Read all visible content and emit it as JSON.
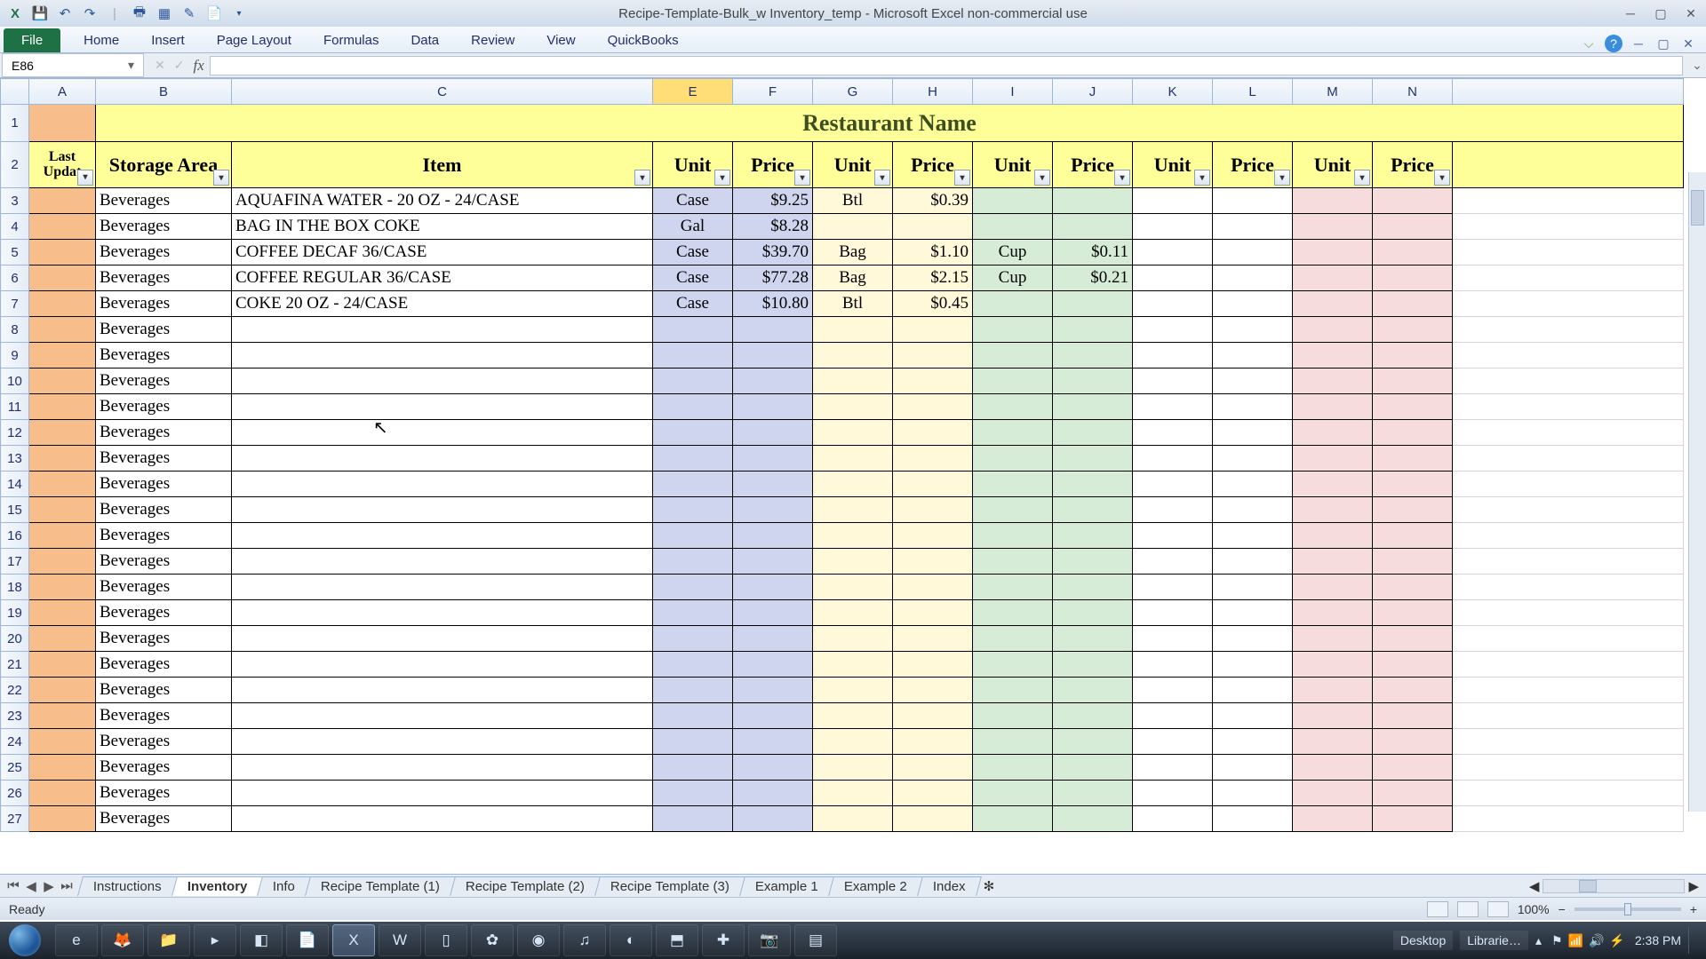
{
  "window": {
    "title": "Recipe-Template-Bulk_w Inventory_temp  -  Microsoft Excel non-commercial use"
  },
  "ribbon": {
    "file": "File",
    "tabs": [
      "Home",
      "Insert",
      "Page Layout",
      "Formulas",
      "Data",
      "Review",
      "View",
      "QuickBooks"
    ]
  },
  "formula": {
    "namebox": "E86",
    "value": ""
  },
  "columns": [
    "A",
    "B",
    "C",
    "E",
    "F",
    "G",
    "H",
    "I",
    "J",
    "K",
    "L",
    "M",
    "N"
  ],
  "selected_col": "E",
  "header": {
    "title": "Restaurant Name",
    "lastUpdated": "Last Updat",
    "storage": "Storage Area",
    "item": "Item",
    "pairs": [
      "Unit",
      "Price",
      "Unit",
      "Price",
      "Unit",
      "Price",
      "Unit",
      "Price",
      "Unit",
      "Price"
    ]
  },
  "rows": [
    {
      "n": 3,
      "area": "Beverages",
      "item": "AQUAFINA WATER - 20 OZ - 24/CASE",
      "u1": "Case",
      "p1": "$9.25",
      "u2": "Btl",
      "p2": "$0.39",
      "u3": "",
      "p3": "",
      "u4": "",
      "p4": "",
      "u5": "",
      "p5": ""
    },
    {
      "n": 4,
      "area": "Beverages",
      "item": "BAG IN THE BOX COKE",
      "u1": "Gal",
      "p1": "$8.28",
      "u2": "",
      "p2": "",
      "u3": "",
      "p3": "",
      "u4": "",
      "p4": "",
      "u5": "",
      "p5": ""
    },
    {
      "n": 5,
      "area": "Beverages",
      "item": "COFFEE DECAF 36/CASE",
      "u1": "Case",
      "p1": "$39.70",
      "u2": "Bag",
      "p2": "$1.10",
      "u3": "Cup",
      "p3": "$0.11",
      "u4": "",
      "p4": "",
      "u5": "",
      "p5": ""
    },
    {
      "n": 6,
      "area": "Beverages",
      "item": "COFFEE REGULAR 36/CASE",
      "u1": "Case",
      "p1": "$77.28",
      "u2": "Bag",
      "p2": "$2.15",
      "u3": "Cup",
      "p3": "$0.21",
      "u4": "",
      "p4": "",
      "u5": "",
      "p5": ""
    },
    {
      "n": 7,
      "area": "Beverages",
      "item": "COKE 20 OZ - 24/CASE",
      "u1": "Case",
      "p1": "$10.80",
      "u2": "Btl",
      "p2": "$0.45",
      "u3": "",
      "p3": "",
      "u4": "",
      "p4": "",
      "u5": "",
      "p5": ""
    },
    {
      "n": 8,
      "area": "Beverages",
      "item": "",
      "u1": "",
      "p1": "",
      "u2": "",
      "p2": "",
      "u3": "",
      "p3": "",
      "u4": "",
      "p4": "",
      "u5": "",
      "p5": ""
    },
    {
      "n": 9,
      "area": "Beverages",
      "item": "",
      "u1": "",
      "p1": "",
      "u2": "",
      "p2": "",
      "u3": "",
      "p3": "",
      "u4": "",
      "p4": "",
      "u5": "",
      "p5": ""
    },
    {
      "n": 10,
      "area": "Beverages",
      "item": "",
      "u1": "",
      "p1": "",
      "u2": "",
      "p2": "",
      "u3": "",
      "p3": "",
      "u4": "",
      "p4": "",
      "u5": "",
      "p5": ""
    },
    {
      "n": 11,
      "area": "Beverages",
      "item": "",
      "u1": "",
      "p1": "",
      "u2": "",
      "p2": "",
      "u3": "",
      "p3": "",
      "u4": "",
      "p4": "",
      "u5": "",
      "p5": ""
    },
    {
      "n": 12,
      "area": "Beverages",
      "item": "",
      "u1": "",
      "p1": "",
      "u2": "",
      "p2": "",
      "u3": "",
      "p3": "",
      "u4": "",
      "p4": "",
      "u5": "",
      "p5": ""
    },
    {
      "n": 13,
      "area": "Beverages",
      "item": "",
      "u1": "",
      "p1": "",
      "u2": "",
      "p2": "",
      "u3": "",
      "p3": "",
      "u4": "",
      "p4": "",
      "u5": "",
      "p5": ""
    },
    {
      "n": 14,
      "area": "Beverages",
      "item": "",
      "u1": "",
      "p1": "",
      "u2": "",
      "p2": "",
      "u3": "",
      "p3": "",
      "u4": "",
      "p4": "",
      "u5": "",
      "p5": ""
    },
    {
      "n": 15,
      "area": "Beverages",
      "item": "",
      "u1": "",
      "p1": "",
      "u2": "",
      "p2": "",
      "u3": "",
      "p3": "",
      "u4": "",
      "p4": "",
      "u5": "",
      "p5": ""
    },
    {
      "n": 16,
      "area": "Beverages",
      "item": "",
      "u1": "",
      "p1": "",
      "u2": "",
      "p2": "",
      "u3": "",
      "p3": "",
      "u4": "",
      "p4": "",
      "u5": "",
      "p5": ""
    },
    {
      "n": 17,
      "area": "Beverages",
      "item": "",
      "u1": "",
      "p1": "",
      "u2": "",
      "p2": "",
      "u3": "",
      "p3": "",
      "u4": "",
      "p4": "",
      "u5": "",
      "p5": ""
    },
    {
      "n": 18,
      "area": "Beverages",
      "item": "",
      "u1": "",
      "p1": "",
      "u2": "",
      "p2": "",
      "u3": "",
      "p3": "",
      "u4": "",
      "p4": "",
      "u5": "",
      "p5": ""
    },
    {
      "n": 19,
      "area": "Beverages",
      "item": "",
      "u1": "",
      "p1": "",
      "u2": "",
      "p2": "",
      "u3": "",
      "p3": "",
      "u4": "",
      "p4": "",
      "u5": "",
      "p5": ""
    },
    {
      "n": 20,
      "area": "Beverages",
      "item": "",
      "u1": "",
      "p1": "",
      "u2": "",
      "p2": "",
      "u3": "",
      "p3": "",
      "u4": "",
      "p4": "",
      "u5": "",
      "p5": ""
    },
    {
      "n": 21,
      "area": "Beverages",
      "item": "",
      "u1": "",
      "p1": "",
      "u2": "",
      "p2": "",
      "u3": "",
      "p3": "",
      "u4": "",
      "p4": "",
      "u5": "",
      "p5": ""
    },
    {
      "n": 22,
      "area": "Beverages",
      "item": "",
      "u1": "",
      "p1": "",
      "u2": "",
      "p2": "",
      "u3": "",
      "p3": "",
      "u4": "",
      "p4": "",
      "u5": "",
      "p5": ""
    },
    {
      "n": 23,
      "area": "Beverages",
      "item": "",
      "u1": "",
      "p1": "",
      "u2": "",
      "p2": "",
      "u3": "",
      "p3": "",
      "u4": "",
      "p4": "",
      "u5": "",
      "p5": ""
    },
    {
      "n": 24,
      "area": "Beverages",
      "item": "",
      "u1": "",
      "p1": "",
      "u2": "",
      "p2": "",
      "u3": "",
      "p3": "",
      "u4": "",
      "p4": "",
      "u5": "",
      "p5": ""
    },
    {
      "n": 25,
      "area": "Beverages",
      "item": "",
      "u1": "",
      "p1": "",
      "u2": "",
      "p2": "",
      "u3": "",
      "p3": "",
      "u4": "",
      "p4": "",
      "u5": "",
      "p5": ""
    },
    {
      "n": 26,
      "area": "Beverages",
      "item": "",
      "u1": "",
      "p1": "",
      "u2": "",
      "p2": "",
      "u3": "",
      "p3": "",
      "u4": "",
      "p4": "",
      "u5": "",
      "p5": ""
    },
    {
      "n": 27,
      "area": "Beverages",
      "item": "",
      "u1": "",
      "p1": "",
      "u2": "",
      "p2": "",
      "u3": "",
      "p3": "",
      "u4": "",
      "p4": "",
      "u5": "",
      "p5": ""
    }
  ],
  "sheets": [
    "Instructions",
    "Inventory",
    "Info",
    "Recipe Template (1)",
    "Recipe Template (2)",
    "Recipe Template (3)",
    "Example 1",
    "Example 2",
    "Index"
  ],
  "active_sheet": "Inventory",
  "status": {
    "ready": "Ready",
    "zoom": "100%"
  },
  "taskbar": {
    "desktop": "Desktop",
    "libraries": "Librarie…",
    "clock": "2:38 PM"
  }
}
